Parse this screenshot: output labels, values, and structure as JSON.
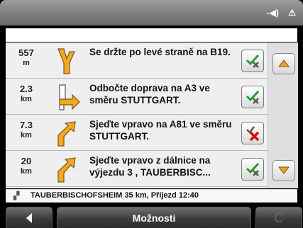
{
  "status": {
    "sound_icon": "-◀)",
    "warning_icon": "⚠"
  },
  "instructions": [
    {
      "distance": "557",
      "unit": "m",
      "text": "Se držte po levé straně na B19.",
      "maneuver": "keep-left",
      "status": "ok"
    },
    {
      "distance": "2.3",
      "unit": "km",
      "text": "Odbočte doprava na A3 ve směru STUTTGART.",
      "maneuver": "turn-right",
      "status": "ok"
    },
    {
      "distance": "7.3",
      "unit": "km",
      "text": "Sjeďte vpravo na A81 ve směru STUTTGART.",
      "maneuver": "exit-right",
      "status": "blocked"
    },
    {
      "distance": "20",
      "unit": "km",
      "text": "Sjeďte vpravo z dálnice na výjezdu 3 , TAUBERBISC...",
      "maneuver": "exit-right",
      "status": "ok"
    }
  ],
  "destination": {
    "text": "TAUBERBISCHOFSHEIM 35 km, Příjezd 12:40"
  },
  "bottom": {
    "options_label": "Možnosti",
    "right_icon": "C"
  },
  "colors": {
    "arrow_fill": "#f5a623",
    "check": "#2a9d2a",
    "cross_red": "#d01010"
  }
}
